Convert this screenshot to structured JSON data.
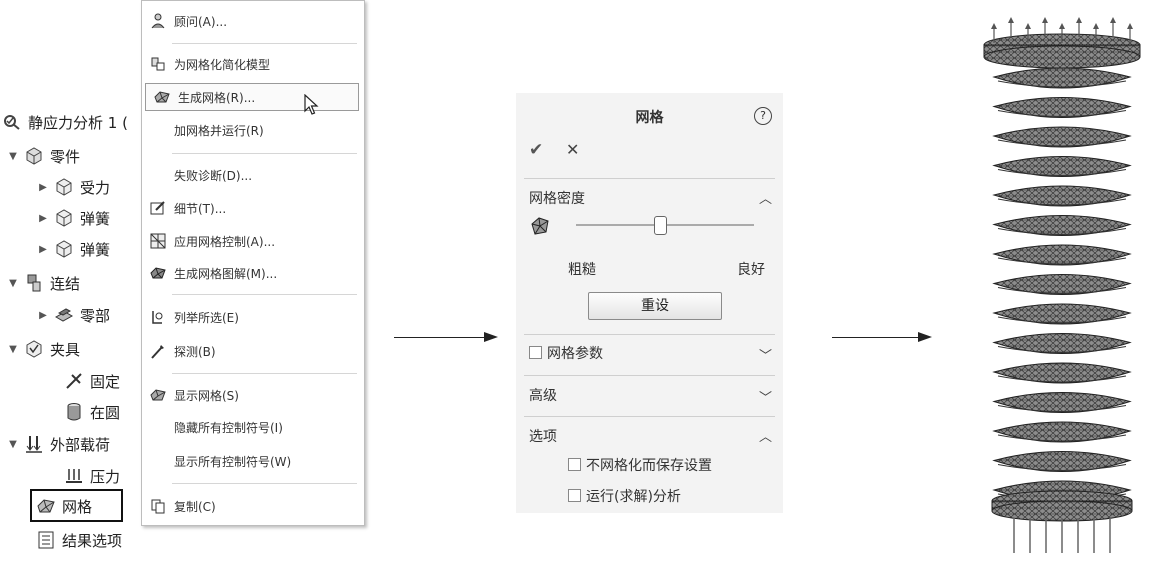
{
  "tree": {
    "study": "静应力分析 1 (",
    "parts": "零件",
    "part1": "受力",
    "part2": "弹簧",
    "part3": "弹簧",
    "connections": "连结",
    "component": "零部",
    "fixtures": "夹具",
    "fixed": "固定",
    "oncyl": "在圆",
    "external_loads": "外部载荷",
    "pressure": "压力",
    "mesh": "网格",
    "result_options": "结果选项"
  },
  "context_menu": {
    "items": [
      {
        "label": "顾问(A)...",
        "icon": "advisor-icon"
      },
      {
        "label": "为网格化简化模型",
        "icon": "simplify-model-icon"
      },
      {
        "label": "生成网格(R)...",
        "icon": "create-mesh-icon"
      },
      {
        "label": "加网格并运行(R)",
        "icon": ""
      },
      {
        "label": "失败诊断(D)...",
        "icon": ""
      },
      {
        "label": "细节(T)...",
        "icon": "details-icon"
      },
      {
        "label": "应用网格控制(A)...",
        "icon": "mesh-control-icon"
      },
      {
        "label": "生成网格图解(M)...",
        "icon": "mesh-plot-icon"
      },
      {
        "label": "列举所选(E)",
        "icon": "list-selected-icon"
      },
      {
        "label": "探测(B)",
        "icon": "probe-icon"
      },
      {
        "label": "显示网格(S)",
        "icon": "show-mesh-icon"
      },
      {
        "label": "隐藏所有控制符号(I)",
        "icon": ""
      },
      {
        "label": "显示所有控制符号(W)",
        "icon": ""
      },
      {
        "label": "复制(C)",
        "icon": "copy-icon"
      }
    ]
  },
  "mesh_panel": {
    "title": "网格",
    "help": "?",
    "ok": "✔",
    "cancel": "✕",
    "density_section": "网格密度",
    "coarse": "粗糙",
    "fine": "良好",
    "reset": "重设",
    "mesh_params": "网格参数",
    "advanced": "高级",
    "options": "选项",
    "option1": "不网格化而保存设置",
    "option2": "运行(求解)分析",
    "density_level": 0.47
  }
}
